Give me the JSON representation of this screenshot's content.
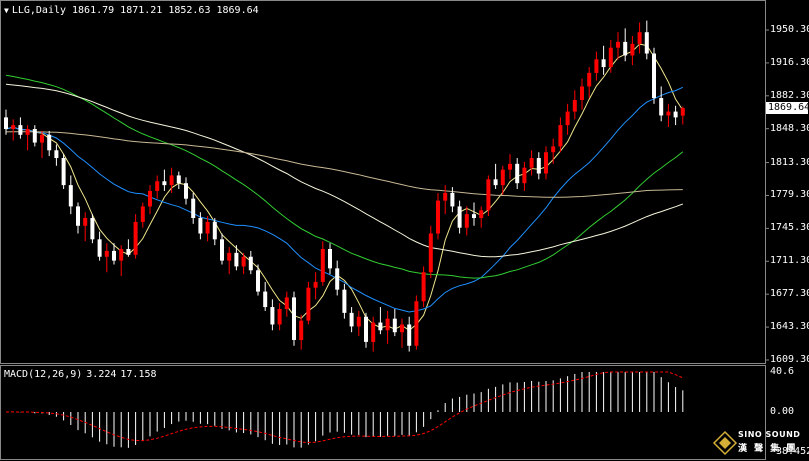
{
  "header": {
    "symbol": "LLG,Daily",
    "open": "1861.79",
    "high": "1871.21",
    "low": "1852.63",
    "close": "1869.64"
  },
  "macd_header": {
    "name": "MACD(12,26,9)",
    "main": "3.224",
    "signal": "17.158"
  },
  "price_axis": {
    "labels": [
      "1950.30",
      "1916.30",
      "1882.30",
      "1848.30",
      "1813.30",
      "1779.30",
      "1745.30",
      "1711.30",
      "1677.30",
      "1643.30",
      "1609.30"
    ],
    "current_price": "1869.64"
  },
  "macd_axis": {
    "labels": [
      "40.6",
      "0.00",
      "-38.452"
    ]
  },
  "logo": {
    "line1": "SINO SOUND",
    "line2": "漢 聲 集 團"
  },
  "colors": {
    "background": "#000000",
    "bull_candle": "#ff0000",
    "bear_candle": "#ffffff",
    "ma_fast": "#f0e68c",
    "ma_blue": "#1e90ff",
    "ma_green": "#32cd32",
    "ma_white": "#f5f5dc",
    "ma_tan": "#c8b894",
    "macd_hist": "#ffffff",
    "macd_signal": "#ff0000"
  },
  "chart_data": {
    "type": "candlestick",
    "timeframe": "Daily",
    "symbol": "LLG",
    "ylim": [
      1609.3,
      1965
    ],
    "candles": [
      [
        1860,
        1868,
        1842,
        1848
      ],
      [
        1848,
        1858,
        1836,
        1852
      ],
      [
        1852,
        1860,
        1838,
        1842
      ],
      [
        1842,
        1852,
        1826,
        1848
      ],
      [
        1848,
        1852,
        1830,
        1834
      ],
      [
        1834,
        1846,
        1818,
        1842
      ],
      [
        1842,
        1846,
        1820,
        1826
      ],
      [
        1826,
        1832,
        1810,
        1818
      ],
      [
        1818,
        1822,
        1786,
        1790
      ],
      [
        1790,
        1800,
        1760,
        1768
      ],
      [
        1768,
        1772,
        1740,
        1748
      ],
      [
        1748,
        1762,
        1732,
        1756
      ],
      [
        1756,
        1760,
        1730,
        1734
      ],
      [
        1734,
        1742,
        1712,
        1716
      ],
      [
        1716,
        1730,
        1700,
        1722
      ],
      [
        1722,
        1730,
        1708,
        1712
      ],
      [
        1712,
        1728,
        1696,
        1724
      ],
      [
        1724,
        1734,
        1716,
        1718
      ],
      [
        1718,
        1760,
        1714,
        1752
      ],
      [
        1752,
        1772,
        1746,
        1768
      ],
      [
        1768,
        1790,
        1760,
        1784
      ],
      [
        1784,
        1800,
        1776,
        1794
      ],
      [
        1794,
        1806,
        1784,
        1790
      ],
      [
        1790,
        1808,
        1782,
        1800
      ],
      [
        1800,
        1804,
        1786,
        1792
      ],
      [
        1792,
        1798,
        1770,
        1776
      ],
      [
        1776,
        1782,
        1750,
        1756
      ],
      [
        1756,
        1762,
        1734,
        1740
      ],
      [
        1740,
        1758,
        1732,
        1752
      ],
      [
        1752,
        1756,
        1728,
        1734
      ],
      [
        1734,
        1740,
        1708,
        1712
      ],
      [
        1712,
        1726,
        1698,
        1720
      ],
      [
        1720,
        1728,
        1702,
        1706
      ],
      [
        1706,
        1720,
        1698,
        1716
      ],
      [
        1716,
        1722,
        1698,
        1702
      ],
      [
        1702,
        1708,
        1676,
        1680
      ],
      [
        1680,
        1690,
        1660,
        1664
      ],
      [
        1664,
        1672,
        1640,
        1646
      ],
      [
        1646,
        1668,
        1640,
        1662
      ],
      [
        1662,
        1680,
        1654,
        1674
      ],
      [
        1674,
        1680,
        1624,
        1630
      ],
      [
        1630,
        1656,
        1620,
        1650
      ],
      [
        1650,
        1690,
        1646,
        1684
      ],
      [
        1684,
        1700,
        1672,
        1690
      ],
      [
        1690,
        1732,
        1686,
        1724
      ],
      [
        1724,
        1730,
        1698,
        1704
      ],
      [
        1704,
        1712,
        1676,
        1682
      ],
      [
        1682,
        1688,
        1652,
        1658
      ],
      [
        1658,
        1664,
        1638,
        1644
      ],
      [
        1644,
        1660,
        1634,
        1654
      ],
      [
        1654,
        1658,
        1622,
        1628
      ],
      [
        1628,
        1654,
        1618,
        1648
      ],
      [
        1648,
        1664,
        1636,
        1640
      ],
      [
        1640,
        1660,
        1626,
        1652
      ],
      [
        1652,
        1662,
        1634,
        1638
      ],
      [
        1638,
        1652,
        1622,
        1646
      ],
      [
        1646,
        1654,
        1618,
        1624
      ],
      [
        1624,
        1676,
        1620,
        1670
      ],
      [
        1670,
        1706,
        1664,
        1700
      ],
      [
        1700,
        1748,
        1694,
        1740
      ],
      [
        1740,
        1782,
        1734,
        1774
      ],
      [
        1774,
        1790,
        1760,
        1782
      ],
      [
        1782,
        1788,
        1762,
        1768
      ],
      [
        1768,
        1774,
        1740,
        1746
      ],
      [
        1746,
        1768,
        1738,
        1760
      ],
      [
        1760,
        1772,
        1748,
        1756
      ],
      [
        1756,
        1768,
        1746,
        1764
      ],
      [
        1764,
        1800,
        1758,
        1796
      ],
      [
        1796,
        1812,
        1786,
        1790
      ],
      [
        1790,
        1810,
        1780,
        1806
      ],
      [
        1806,
        1822,
        1796,
        1812
      ],
      [
        1812,
        1818,
        1786,
        1792
      ],
      [
        1792,
        1814,
        1784,
        1808
      ],
      [
        1808,
        1826,
        1800,
        1818
      ],
      [
        1818,
        1824,
        1796,
        1802
      ],
      [
        1802,
        1830,
        1796,
        1824
      ],
      [
        1824,
        1838,
        1812,
        1830
      ],
      [
        1830,
        1860,
        1824,
        1852
      ],
      [
        1852,
        1874,
        1842,
        1866
      ],
      [
        1866,
        1888,
        1858,
        1878
      ],
      [
        1878,
        1900,
        1868,
        1892
      ],
      [
        1892,
        1912,
        1880,
        1906
      ],
      [
        1906,
        1928,
        1898,
        1920
      ],
      [
        1920,
        1934,
        1904,
        1912
      ],
      [
        1912,
        1940,
        1906,
        1932
      ],
      [
        1932,
        1948,
        1920,
        1938
      ],
      [
        1938,
        1952,
        1918,
        1924
      ],
      [
        1924,
        1944,
        1914,
        1936
      ],
      [
        1936,
        1958,
        1926,
        1948
      ],
      [
        1948,
        1960,
        1920,
        1926
      ],
      [
        1926,
        1932,
        1874,
        1880
      ],
      [
        1880,
        1892,
        1856,
        1862
      ],
      [
        1862,
        1874,
        1850,
        1866
      ],
      [
        1866,
        1872,
        1852,
        1860
      ],
      [
        1861.79,
        1871.21,
        1852.63,
        1869.64
      ]
    ],
    "macd_ylim": [
      -38.452,
      40.6
    ]
  }
}
